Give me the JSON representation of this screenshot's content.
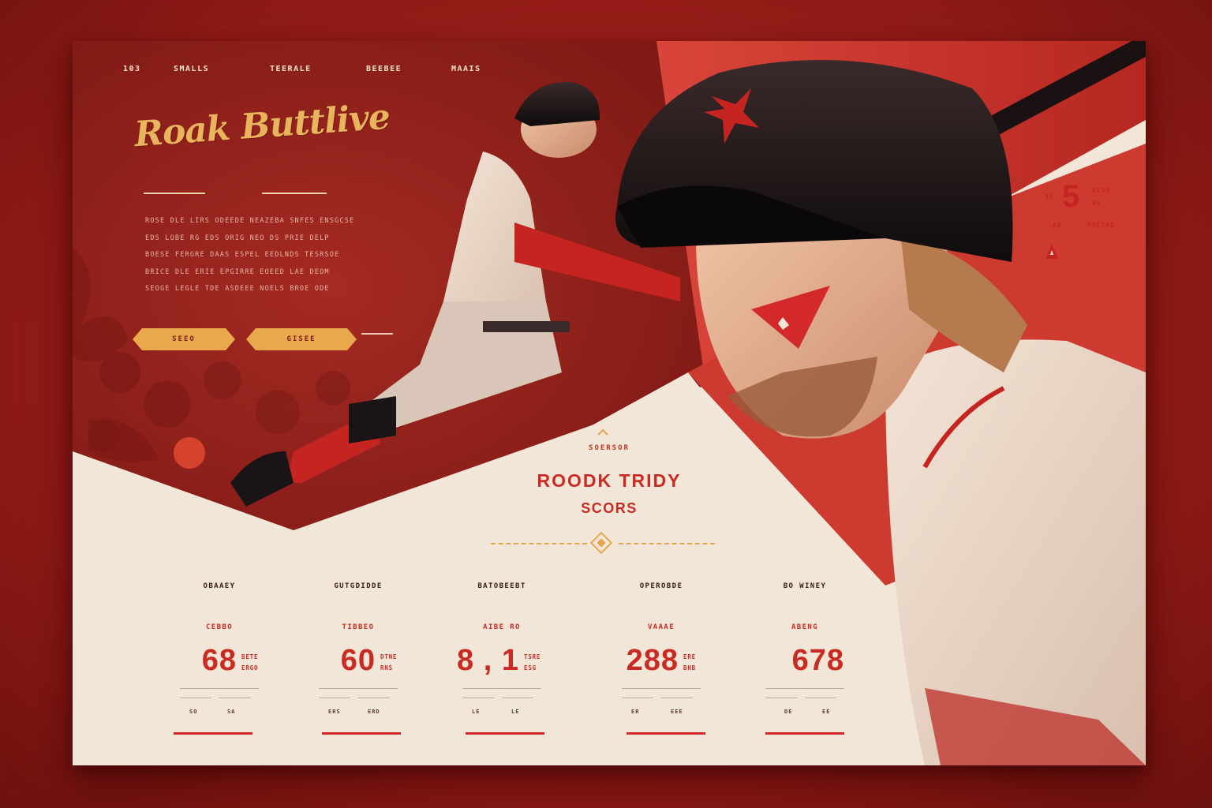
{
  "nav": {
    "items": [
      "103",
      "SMALLS",
      "TEERALE",
      "BEEBEE",
      "MAAIS"
    ]
  },
  "hero": {
    "script_title": "Roak Buttlive",
    "intro_lines": [
      "ROSE DLE LIRS ODEEDE NEAZEBA SNFES ENSGCSE",
      "EDS LOBE RG EDS ORIG NEO DS PRIE DELP",
      "BOESE FERGRE DAAS ESPEL EEDLNDS TESRSOE",
      "BRICE DLE ERIE EPGIRRE EOEED LAE DEOM",
      "SEOGE LEGLE TDE ASDEEE NOELS BROE ODE"
    ],
    "buttons": {
      "primary": "SEEO",
      "secondary": "GISEE"
    }
  },
  "badge": {
    "number": "5",
    "left_tag": "35",
    "right_tag_1": "EE30",
    "right_tag_2": "SE",
    "foot_1": "AB",
    "foot_2": "PRE7RE"
  },
  "section": {
    "eyebrow": "SOERSOR",
    "title": "ROODK TRIDY",
    "subtitle": "SCORS"
  },
  "stats": [
    {
      "label": "OBAAEY",
      "sub": "CEBBO",
      "value": "68",
      "unit_1": "BETE",
      "unit_2": "ERGO",
      "foot_1": "SO",
      "foot_2": "SA"
    },
    {
      "label": "GUTGDIDDE",
      "sub": "TIBBEO",
      "value": "60",
      "unit_1": "DTNE",
      "unit_2": "RNS",
      "foot_1": "ERS",
      "foot_2": "ERD"
    },
    {
      "label": "BATOBEEBT",
      "sub": "AIBE RO",
      "value": "8 , 1",
      "unit_1": "TSRE",
      "unit_2": "ESG",
      "foot_1": "LE",
      "foot_2": "LE"
    },
    {
      "label": "OPEROBDE",
      "sub": "VAAAE",
      "value": "288",
      "unit_1": "ERE",
      "unit_2": "BHB",
      "foot_1": "ER",
      "foot_2": "EEE"
    },
    {
      "label": "BO WINEY",
      "sub": "ABENG",
      "value": "678",
      "unit_1": "",
      "unit_2": "",
      "foot_1": "DE",
      "foot_2": "EE"
    }
  ],
  "colors": {
    "brand_red": "#c92a22",
    "deep_red": "#8e1a16",
    "cream": "#f1e6d8",
    "gold": "#e9a84c"
  },
  "icons": [
    "star-logo-icon",
    "chevron-up-icon",
    "diamond-icon",
    "triangle-emblem-icon"
  ]
}
